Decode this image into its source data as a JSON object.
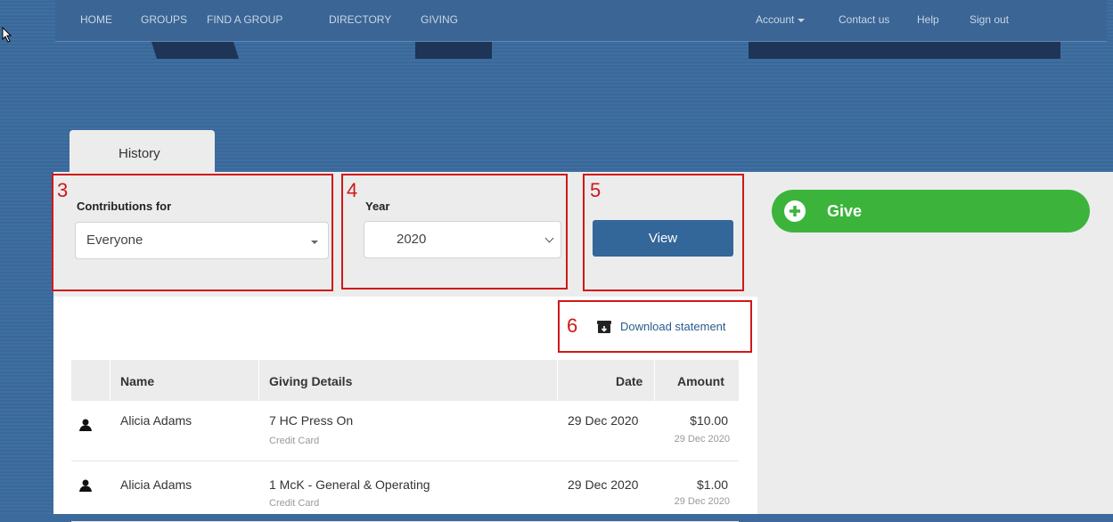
{
  "nav": {
    "left": [
      "HOME",
      "GROUPS",
      "FIND A GROUP",
      "DIRECTORY",
      "GIVING"
    ],
    "account": "Account",
    "contact": "Contact us",
    "help": "Help",
    "signout": "Sign out"
  },
  "tab": {
    "label": "History"
  },
  "filters": {
    "contributions_label": "Contributions for",
    "contributions_value": "Everyone",
    "year_label": "Year",
    "year_value": "2020",
    "view_label": "View"
  },
  "annotations": [
    "3",
    "4",
    "5",
    "6"
  ],
  "download": {
    "label": "Download statement"
  },
  "table": {
    "headers": {
      "name": "Name",
      "details": "Giving Details",
      "date": "Date",
      "amount": "Amount"
    },
    "rows": [
      {
        "name": "Alicia Adams",
        "detail": "7 HC Press On",
        "method": "Credit Card",
        "date": "29 Dec 2020",
        "amount": "$10.00",
        "amount_date": "29 Dec 2020"
      },
      {
        "name": "Alicia Adams",
        "detail": "1 McK - General & Operating",
        "method": "Credit Card",
        "date": "29 Dec 2020",
        "amount": "$1.00",
        "amount_date": "29 Dec 2020"
      }
    ]
  },
  "give": {
    "label": "Give"
  },
  "colors": {
    "accent": "#336699",
    "give": "#3cb43c",
    "annotation": "#d01818"
  }
}
